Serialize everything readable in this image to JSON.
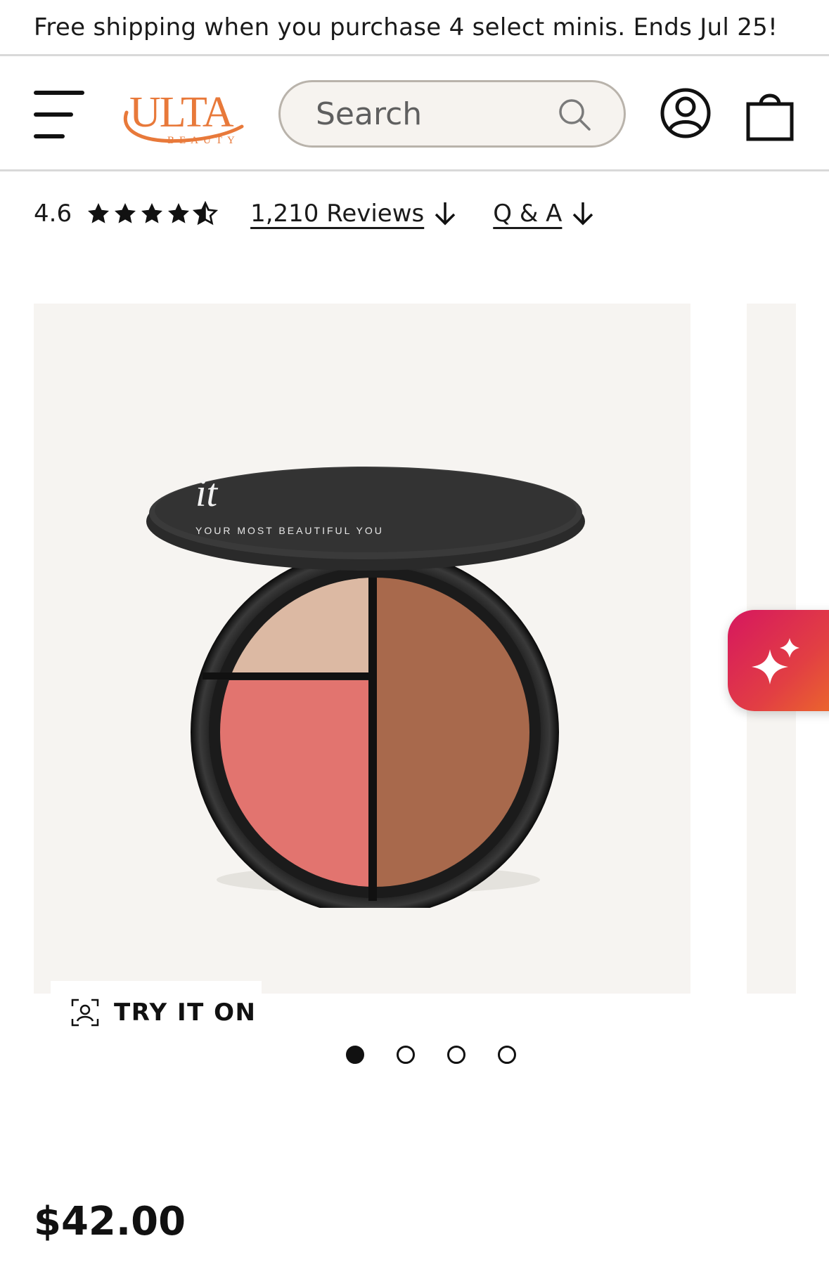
{
  "promo": {
    "text": "Free shipping when you purchase 4 select minis. Ends Jul 25!"
  },
  "header": {
    "logo_text": "ULTA",
    "logo_subtext": "BEAUTY",
    "search_placeholder": "Search",
    "icons": [
      "hamburger-menu-icon",
      "search-icon",
      "account-icon",
      "shopping-bag-icon"
    ],
    "colors": {
      "logo": "#e8793a",
      "border": "#d9d9d9",
      "search_bg": "#f6f3ef"
    }
  },
  "rating": {
    "value": "4.6",
    "stars": 4.6,
    "reviews_label": "1,210 Reviews",
    "qa_label": "Q & A"
  },
  "product": {
    "palette_brand": "it",
    "palette_tagline": "YOUR MOST BEAUTIFUL YOU",
    "gallery_slides": 4,
    "active_slide": 1,
    "try_on_label": "TRY IT ON",
    "price": "$42.00",
    "swatch_colors": {
      "highlighter": "#dcb9a3",
      "blush": "#e2746f",
      "bronzer": "#a8694c"
    },
    "ai_button_gradient": [
      "#d6175f",
      "#ec6a2a"
    ]
  }
}
